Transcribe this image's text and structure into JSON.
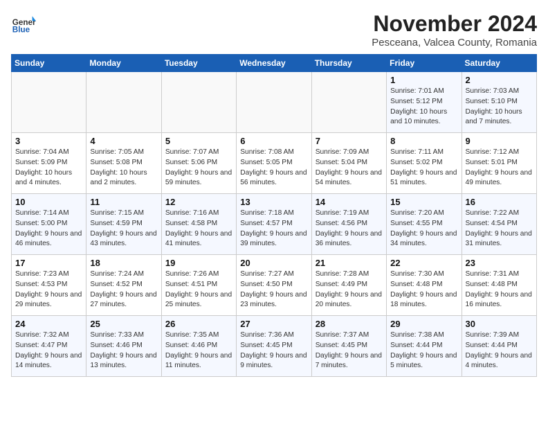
{
  "header": {
    "logo_general": "General",
    "logo_blue": "Blue",
    "month_title": "November 2024",
    "location": "Pesceana, Valcea County, Romania"
  },
  "days_of_week": [
    "Sunday",
    "Monday",
    "Tuesday",
    "Wednesday",
    "Thursday",
    "Friday",
    "Saturday"
  ],
  "weeks": [
    [
      {
        "day": "",
        "info": ""
      },
      {
        "day": "",
        "info": ""
      },
      {
        "day": "",
        "info": ""
      },
      {
        "day": "",
        "info": ""
      },
      {
        "day": "",
        "info": ""
      },
      {
        "day": "1",
        "info": "Sunrise: 7:01 AM\nSunset: 5:12 PM\nDaylight: 10 hours and 10 minutes."
      },
      {
        "day": "2",
        "info": "Sunrise: 7:03 AM\nSunset: 5:10 PM\nDaylight: 10 hours and 7 minutes."
      }
    ],
    [
      {
        "day": "3",
        "info": "Sunrise: 7:04 AM\nSunset: 5:09 PM\nDaylight: 10 hours and 4 minutes."
      },
      {
        "day": "4",
        "info": "Sunrise: 7:05 AM\nSunset: 5:08 PM\nDaylight: 10 hours and 2 minutes."
      },
      {
        "day": "5",
        "info": "Sunrise: 7:07 AM\nSunset: 5:06 PM\nDaylight: 9 hours and 59 minutes."
      },
      {
        "day": "6",
        "info": "Sunrise: 7:08 AM\nSunset: 5:05 PM\nDaylight: 9 hours and 56 minutes."
      },
      {
        "day": "7",
        "info": "Sunrise: 7:09 AM\nSunset: 5:04 PM\nDaylight: 9 hours and 54 minutes."
      },
      {
        "day": "8",
        "info": "Sunrise: 7:11 AM\nSunset: 5:02 PM\nDaylight: 9 hours and 51 minutes."
      },
      {
        "day": "9",
        "info": "Sunrise: 7:12 AM\nSunset: 5:01 PM\nDaylight: 9 hours and 49 minutes."
      }
    ],
    [
      {
        "day": "10",
        "info": "Sunrise: 7:14 AM\nSunset: 5:00 PM\nDaylight: 9 hours and 46 minutes."
      },
      {
        "day": "11",
        "info": "Sunrise: 7:15 AM\nSunset: 4:59 PM\nDaylight: 9 hours and 43 minutes."
      },
      {
        "day": "12",
        "info": "Sunrise: 7:16 AM\nSunset: 4:58 PM\nDaylight: 9 hours and 41 minutes."
      },
      {
        "day": "13",
        "info": "Sunrise: 7:18 AM\nSunset: 4:57 PM\nDaylight: 9 hours and 39 minutes."
      },
      {
        "day": "14",
        "info": "Sunrise: 7:19 AM\nSunset: 4:56 PM\nDaylight: 9 hours and 36 minutes."
      },
      {
        "day": "15",
        "info": "Sunrise: 7:20 AM\nSunset: 4:55 PM\nDaylight: 9 hours and 34 minutes."
      },
      {
        "day": "16",
        "info": "Sunrise: 7:22 AM\nSunset: 4:54 PM\nDaylight: 9 hours and 31 minutes."
      }
    ],
    [
      {
        "day": "17",
        "info": "Sunrise: 7:23 AM\nSunset: 4:53 PM\nDaylight: 9 hours and 29 minutes."
      },
      {
        "day": "18",
        "info": "Sunrise: 7:24 AM\nSunset: 4:52 PM\nDaylight: 9 hours and 27 minutes."
      },
      {
        "day": "19",
        "info": "Sunrise: 7:26 AM\nSunset: 4:51 PM\nDaylight: 9 hours and 25 minutes."
      },
      {
        "day": "20",
        "info": "Sunrise: 7:27 AM\nSunset: 4:50 PM\nDaylight: 9 hours and 23 minutes."
      },
      {
        "day": "21",
        "info": "Sunrise: 7:28 AM\nSunset: 4:49 PM\nDaylight: 9 hours and 20 minutes."
      },
      {
        "day": "22",
        "info": "Sunrise: 7:30 AM\nSunset: 4:48 PM\nDaylight: 9 hours and 18 minutes."
      },
      {
        "day": "23",
        "info": "Sunrise: 7:31 AM\nSunset: 4:48 PM\nDaylight: 9 hours and 16 minutes."
      }
    ],
    [
      {
        "day": "24",
        "info": "Sunrise: 7:32 AM\nSunset: 4:47 PM\nDaylight: 9 hours and 14 minutes."
      },
      {
        "day": "25",
        "info": "Sunrise: 7:33 AM\nSunset: 4:46 PM\nDaylight: 9 hours and 13 minutes."
      },
      {
        "day": "26",
        "info": "Sunrise: 7:35 AM\nSunset: 4:46 PM\nDaylight: 9 hours and 11 minutes."
      },
      {
        "day": "27",
        "info": "Sunrise: 7:36 AM\nSunset: 4:45 PM\nDaylight: 9 hours and 9 minutes."
      },
      {
        "day": "28",
        "info": "Sunrise: 7:37 AM\nSunset: 4:45 PM\nDaylight: 9 hours and 7 minutes."
      },
      {
        "day": "29",
        "info": "Sunrise: 7:38 AM\nSunset: 4:44 PM\nDaylight: 9 hours and 5 minutes."
      },
      {
        "day": "30",
        "info": "Sunrise: 7:39 AM\nSunset: 4:44 PM\nDaylight: 9 hours and 4 minutes."
      }
    ]
  ]
}
